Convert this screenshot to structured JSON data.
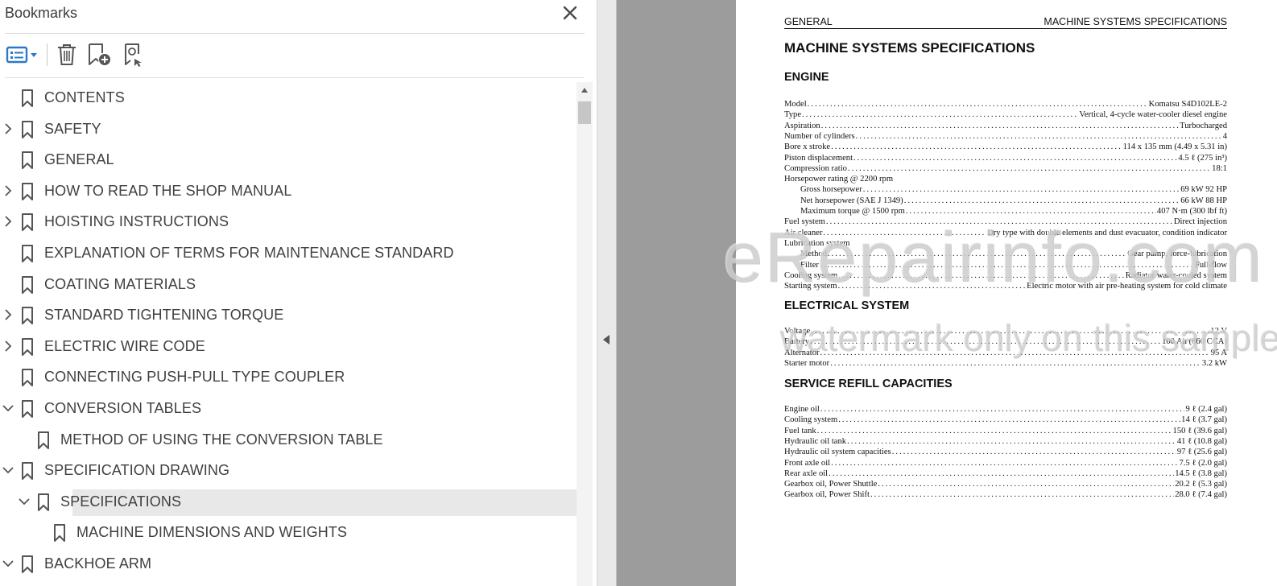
{
  "panel": {
    "title": "Bookmarks",
    "close_icon": "close-icon",
    "toolbar": {
      "options": "options-list-icon",
      "delete": "trash-icon",
      "new": "new-bookmark-icon",
      "find": "find-current-bookmark-icon"
    }
  },
  "bookmarks": [
    {
      "label": "CONTENTS",
      "level": 0,
      "toggle": "none"
    },
    {
      "label": "SAFETY",
      "level": 0,
      "toggle": "collapsed"
    },
    {
      "label": "GENERAL",
      "level": 0,
      "toggle": "none"
    },
    {
      "label": "HOW TO READ THE SHOP MANUAL",
      "level": 0,
      "toggle": "collapsed"
    },
    {
      "label": "HOISTING INSTRUCTIONS",
      "level": 0,
      "toggle": "collapsed"
    },
    {
      "label": "EXPLANATION OF TERMS FOR MAINTENANCE STANDARD",
      "level": 0,
      "toggle": "none"
    },
    {
      "label": "COATING MATERIALS",
      "level": 0,
      "toggle": "none"
    },
    {
      "label": "STANDARD TIGHTENING TORQUE",
      "level": 0,
      "toggle": "collapsed"
    },
    {
      "label": "ELECTRIC WIRE CODE",
      "level": 0,
      "toggle": "collapsed"
    },
    {
      "label": "CONNECTING PUSH-PULL TYPE COUPLER",
      "level": 0,
      "toggle": "none"
    },
    {
      "label": "CONVERSION TABLES",
      "level": 0,
      "toggle": "expanded"
    },
    {
      "label": "METHOD OF USING THE CONVERSION TABLE",
      "level": 1,
      "toggle": "none"
    },
    {
      "label": "SPECIFICATION DRAWING",
      "level": 0,
      "toggle": "expanded"
    },
    {
      "label": "SPECIFICATIONS",
      "level": 1,
      "toggle": "expanded",
      "selected": true
    },
    {
      "label": "MACHINE DIMENSIONS AND WEIGHTS",
      "level": 2,
      "toggle": "none"
    },
    {
      "label": "BACKHOE ARM",
      "level": 0,
      "toggle": "expanded"
    }
  ],
  "document": {
    "running_head_left": "GENERAL",
    "running_head_right": "MACHINE SYSTEMS SPECIFICATIONS",
    "title": "MACHINE SYSTEMS SPECIFICATIONS",
    "sections": [
      {
        "heading": "ENGINE",
        "rows": [
          {
            "k": "Model",
            "v": "Komatsu S4D102LE-2"
          },
          {
            "k": "Type",
            "v": "Vertical, 4-cycle water-cooler diesel engine"
          },
          {
            "k": "Aspiration",
            "v": "Turbocharged"
          },
          {
            "k": "Number of cylinders",
            "v": "4"
          },
          {
            "k": "Bore x stroke",
            "v": "114 x 135 mm (4.49 x 5.31 in)"
          },
          {
            "k": "Piston displacement",
            "v": "4.5 ℓ (275 in³)"
          },
          {
            "k": "Compression ratio",
            "v": "18:1"
          },
          {
            "k": "Horsepower rating @ 2200 rpm",
            "v": ""
          },
          {
            "k": "Gross horsepower",
            "v": "69 kW 92 HP",
            "sub": true
          },
          {
            "k": "Net horsepower (SAE J 1349)",
            "v": "66 kW 88 HP",
            "sub": true
          },
          {
            "k": "Maximum torque @ 1500 rpm",
            "v": "407 N·m (300 lbf ft)",
            "sub": true
          },
          {
            "k": "Fuel system",
            "v": "Direct injection"
          },
          {
            "k": "Air cleaner",
            "v": "Dry type with double elements and dust evacuator, condition indicator"
          },
          {
            "k": "Lubrication system",
            "v": ""
          },
          {
            "k": "Method",
            "v": "Gear pump, force-lubrication",
            "sub": true
          },
          {
            "k": "Filter",
            "v": "Full-flow",
            "sub": true
          },
          {
            "k": "Cooling system",
            "v": "Radiator water-cooled system"
          },
          {
            "k": "Starting system",
            "v": "Electric motor with air pre-heating system for cold climate"
          }
        ]
      },
      {
        "heading": "ELECTRICAL SYSTEM",
        "rows": [
          {
            "k": "Voltage",
            "v": "12 V"
          },
          {
            "k": "Battery",
            "v": "100 Ah (860 CCA)"
          },
          {
            "k": "Alternator",
            "v": "95 A"
          },
          {
            "k": "Starter motor",
            "v": "3.2 kW"
          }
        ]
      },
      {
        "heading": "SERVICE REFILL CAPACITIES",
        "rows": [
          {
            "k": "Engine oil",
            "v": "9 ℓ (2.4 gal)"
          },
          {
            "k": "Cooling system",
            "v": "14 ℓ (3.7 gal)"
          },
          {
            "k": "Fuel tank",
            "v": "150 ℓ (39.6 gal)"
          },
          {
            "k": "Hydraulic oil tank",
            "v": "41 ℓ (10.8 gal)"
          },
          {
            "k": "Hydraulic oil system capacities",
            "v": "97 ℓ (25.6 gal)"
          },
          {
            "k": "Front axle oil",
            "v": "7.5 ℓ (2.0 gal)"
          },
          {
            "k": "Rear axle oil",
            "v": "14.5 ℓ (3.8 gal)"
          },
          {
            "k": "Gearbox oil, Power Shuttle",
            "v": "20.2 ℓ (5.3 gal)"
          },
          {
            "k": "Gearbox oil, Power Shift",
            "v": "28.0 ℓ (7.4 gal)"
          }
        ]
      }
    ]
  },
  "watermark": {
    "line1": "eRepairinfo.com",
    "line2": "watermark only on this sample"
  }
}
